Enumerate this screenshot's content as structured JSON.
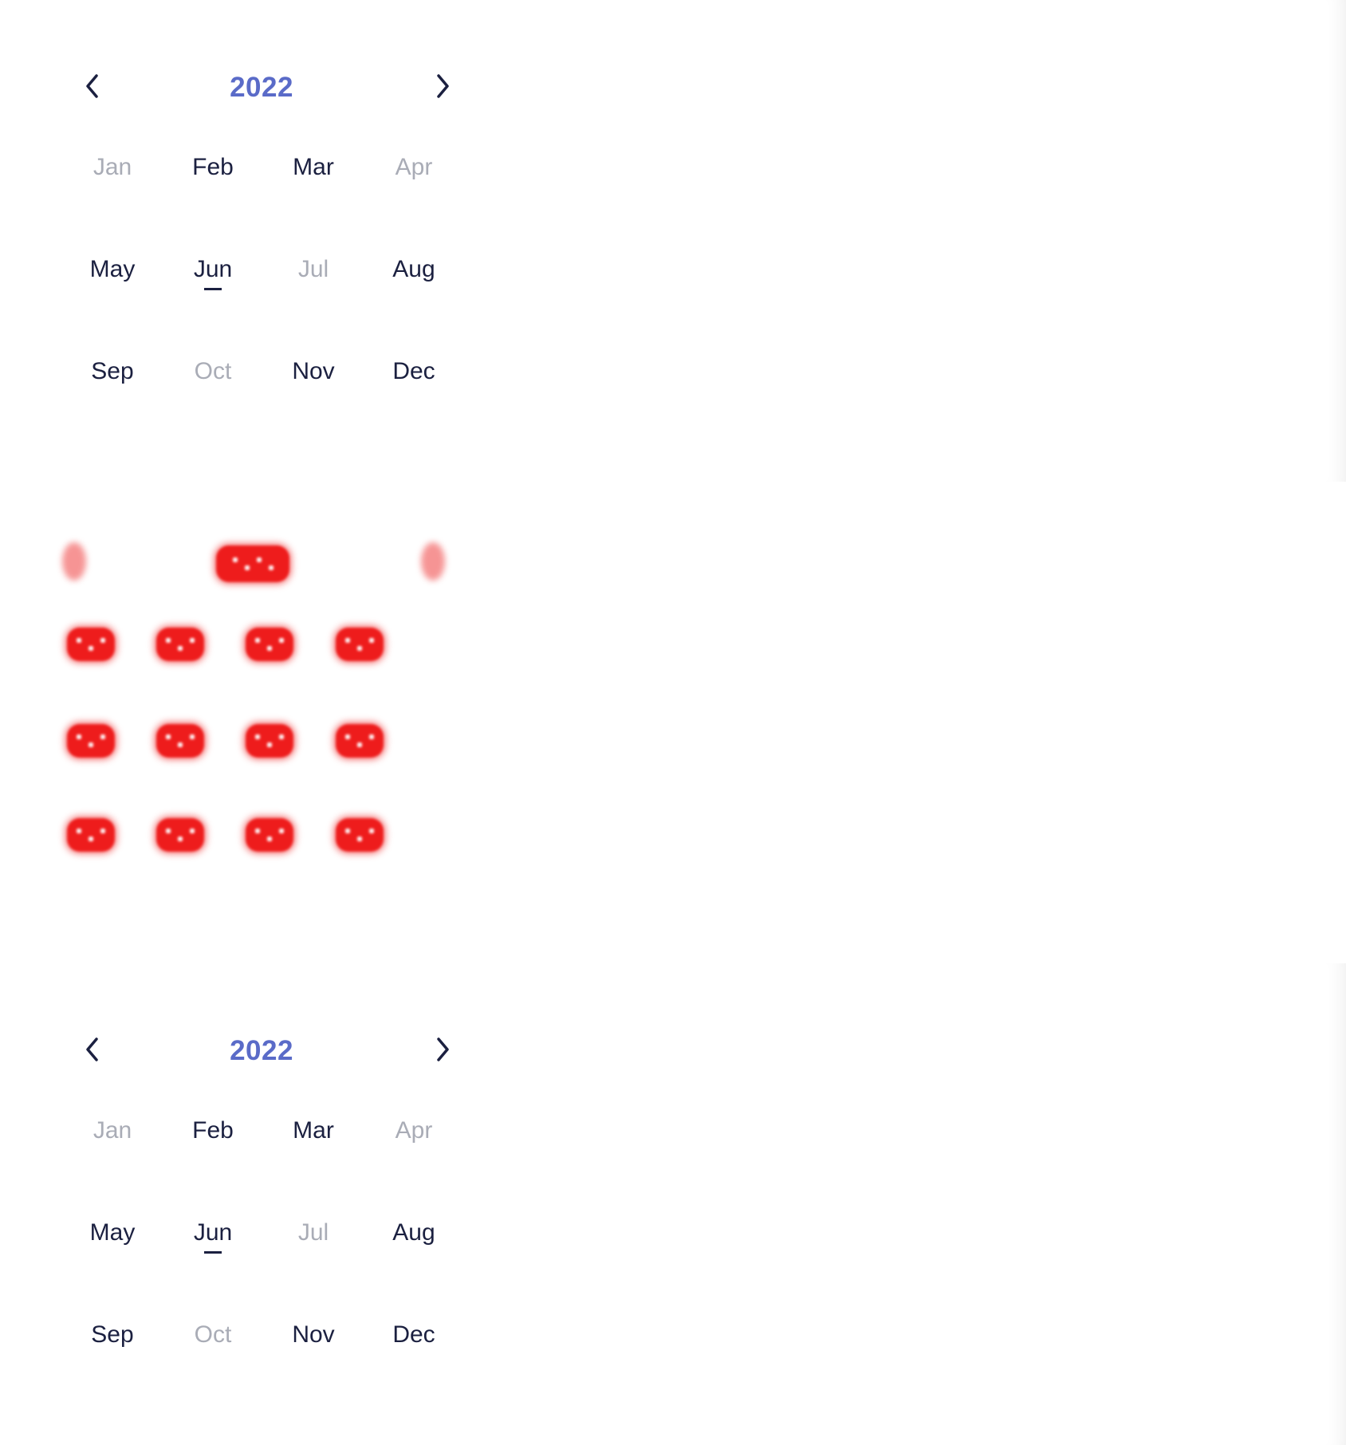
{
  "calendar_top": {
    "year": "2022",
    "nav": {
      "prev": "previous-year",
      "next": "next-year"
    },
    "months": [
      {
        "label": "Jan",
        "disabled": true
      },
      {
        "label": "Feb",
        "disabled": false
      },
      {
        "label": "Mar",
        "disabled": false
      },
      {
        "label": "Apr",
        "disabled": true
      },
      {
        "label": "May",
        "disabled": false
      },
      {
        "label": "Jun",
        "disabled": false,
        "current": true
      },
      {
        "label": "Jul",
        "disabled": true
      },
      {
        "label": "Aug",
        "disabled": false
      },
      {
        "label": "Sep",
        "disabled": false
      },
      {
        "label": "Oct",
        "disabled": true
      },
      {
        "label": "Nov",
        "disabled": false
      },
      {
        "label": "Dec",
        "disabled": false
      }
    ]
  },
  "calendar_bottom": {
    "year": "2022",
    "nav": {
      "prev": "previous-year",
      "next": "next-year"
    },
    "months": [
      {
        "label": "Jan",
        "disabled": true
      },
      {
        "label": "Feb",
        "disabled": false
      },
      {
        "label": "Mar",
        "disabled": false
      },
      {
        "label": "Apr",
        "disabled": true
      },
      {
        "label": "May",
        "disabled": false
      },
      {
        "label": "Jun",
        "disabled": false,
        "current": true
      },
      {
        "label": "Jul",
        "disabled": true
      },
      {
        "label": "Aug",
        "disabled": false
      },
      {
        "label": "Sep",
        "disabled": false
      },
      {
        "label": "Oct",
        "disabled": true
      },
      {
        "label": "Nov",
        "disabled": false
      },
      {
        "label": "Dec",
        "disabled": false
      }
    ]
  },
  "colors": {
    "year": "#5a6bc8",
    "text": "#1b2040",
    "disabled": "#a9acb6",
    "mask": "#ee1c1c"
  },
  "icons": {
    "prev": "chevron-left-icon",
    "next": "chevron-right-icon"
  }
}
